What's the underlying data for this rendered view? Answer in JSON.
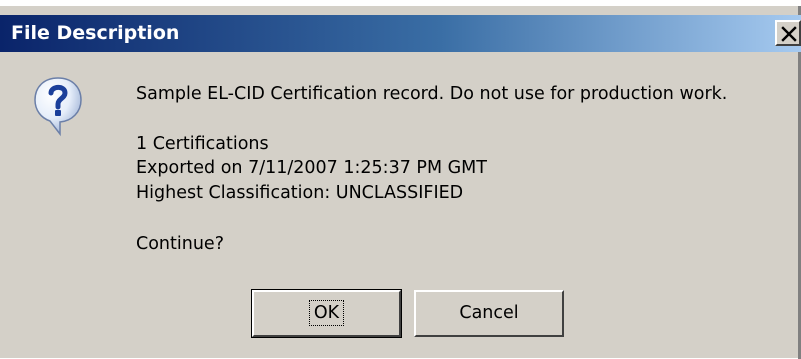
{
  "window": {
    "title": "File Description",
    "close_symbol": "✕"
  },
  "icon": "question-icon",
  "message": {
    "line1": "Sample EL-CID Certification record.  Do not use for production work.",
    "line2": "1 Certifications",
    "line3": "Exported on 7/11/2007 1:25:37 PM GMT",
    "line4": "Highest Classification: UNCLASSIFIED",
    "line5": "Continue?"
  },
  "buttons": {
    "ok_label": "OK",
    "cancel_label": "Cancel"
  },
  "colors": {
    "titlebar_start": "#0a246a",
    "titlebar_end": "#a6caf0",
    "dialog_bg": "#d4d0c8"
  }
}
